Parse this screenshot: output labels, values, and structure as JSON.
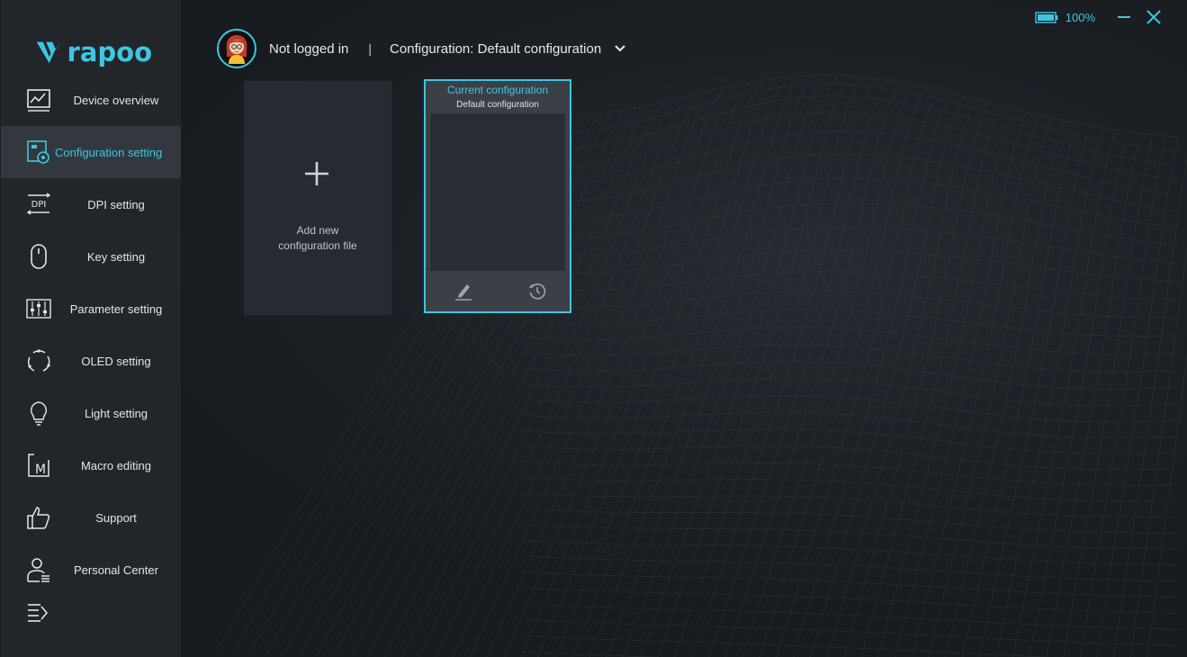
{
  "app": {
    "brand": "rapoo",
    "accent_color": "#3ec6e0"
  },
  "sidebar": {
    "items": [
      {
        "label": "Device overview",
        "icon": "chart-icon",
        "active": false
      },
      {
        "label": "Configuration setting",
        "icon": "config-gear-icon",
        "active": true
      },
      {
        "label": "DPI setting",
        "icon": "dpi-icon",
        "active": false
      },
      {
        "label": "Key setting",
        "icon": "mouse-icon",
        "active": false
      },
      {
        "label": "Parameter setting",
        "icon": "sliders-icon",
        "active": false
      },
      {
        "label": "OLED setting",
        "icon": "oled-cycle-icon",
        "active": false
      },
      {
        "label": "Light setting",
        "icon": "bulb-icon",
        "active": false
      },
      {
        "label": "Macro editing",
        "icon": "macro-icon",
        "active": false
      },
      {
        "label": "Support",
        "icon": "thumbs-up-icon",
        "active": false
      },
      {
        "label": "Personal Center",
        "icon": "person-icon",
        "active": false
      }
    ],
    "collapse_icon": "menu-collapse-icon"
  },
  "header": {
    "user_status": "Not logged in",
    "separator": "|",
    "config_label": "Configuration: Default configuration"
  },
  "window": {
    "battery_percent": "100%"
  },
  "cards": {
    "add": {
      "line1": "Add new",
      "line2": "configuration file"
    },
    "current": {
      "title": "Current configuration",
      "subtitle": "Default configuration"
    }
  }
}
